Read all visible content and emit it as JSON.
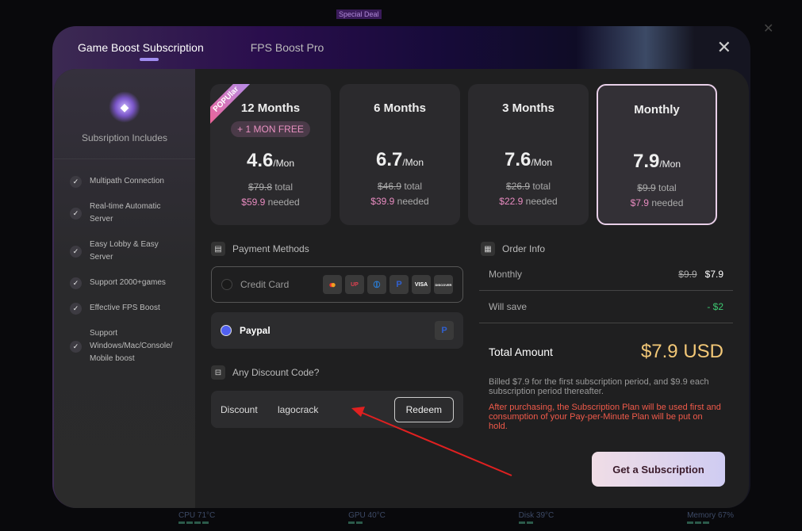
{
  "background": {
    "special_deal": "Special Deal",
    "status": [
      {
        "label": "CPU 71°C"
      },
      {
        "label": "GPU 40°C"
      },
      {
        "label": "Disk 39°C"
      },
      {
        "label": "Memory 67%"
      }
    ]
  },
  "tabs": [
    {
      "label": "Game Boost Subscription",
      "active": true
    },
    {
      "label": "FPS Boost Pro",
      "active": false
    }
  ],
  "sidebar": {
    "title": "Subsription Includes",
    "features": [
      "Multipath Connection",
      "Real-time Automatic Server",
      "Easy Lobby & Easy Server",
      "Support 2000+games",
      "Effective FPS Boost",
      "Support Windows/Mac/Console/ Mobile boost"
    ]
  },
  "plans": [
    {
      "name": "12 Months",
      "badge": "POPUlar",
      "bonus": "+ 1 MON FREE",
      "price": "4.6",
      "unit": "/Mon",
      "total_old": "$79.8",
      "total_label": "total",
      "needed": "$59.9",
      "needed_label": "needed",
      "selected": false
    },
    {
      "name": "6 Months",
      "price": "6.7",
      "unit": "/Mon",
      "total_old": "$46.9",
      "total_label": "total",
      "needed": "$39.9",
      "needed_label": "needed",
      "selected": false
    },
    {
      "name": "3 Months",
      "price": "7.6",
      "unit": "/Mon",
      "total_old": "$26.9",
      "total_label": "total",
      "needed": "$22.9",
      "needed_label": "needed",
      "selected": false
    },
    {
      "name": "Monthly",
      "price": "7.9",
      "unit": "/Mon",
      "total_old": "$9.9",
      "total_label": "total",
      "needed": "$7.9",
      "needed_label": "needed",
      "selected": true
    }
  ],
  "payment": {
    "title": "Payment Methods",
    "credit_card": "Credit Card",
    "card_icons": [
      "mastercard",
      "unionpay",
      "diners",
      "paypal",
      "VISA",
      "DISCOVER"
    ],
    "paypal": "Paypal",
    "selected": "Paypal"
  },
  "discount": {
    "title": "Any Discount Code?",
    "label": "Discount",
    "value": "lagocrack",
    "redeem": "Redeem"
  },
  "order": {
    "title": "Order Info",
    "plan_label": "Monthly",
    "old_price": "$9.9",
    "price": "$7.9",
    "save_label": "Will save",
    "save_value": "- $2",
    "total_label": "Total Amount",
    "total_value": "$7.9 USD",
    "billing_note": "Billed $7.9 for the first subscription period, and $9.9 each subscription period thereafter.",
    "warning": "After purchasing, the Subscription Plan will be used first and consumption of your Pay-per-Minute Plan will be put on hold.",
    "cta": "Get a Subscription"
  },
  "colors": {
    "accent": "#a08cf0",
    "price_pink": "#e88bc0",
    "total_gold": "#f3c877",
    "warning": "#f05a4a",
    "save_green": "#3cc870",
    "annotation_arrow": "#e02020"
  }
}
